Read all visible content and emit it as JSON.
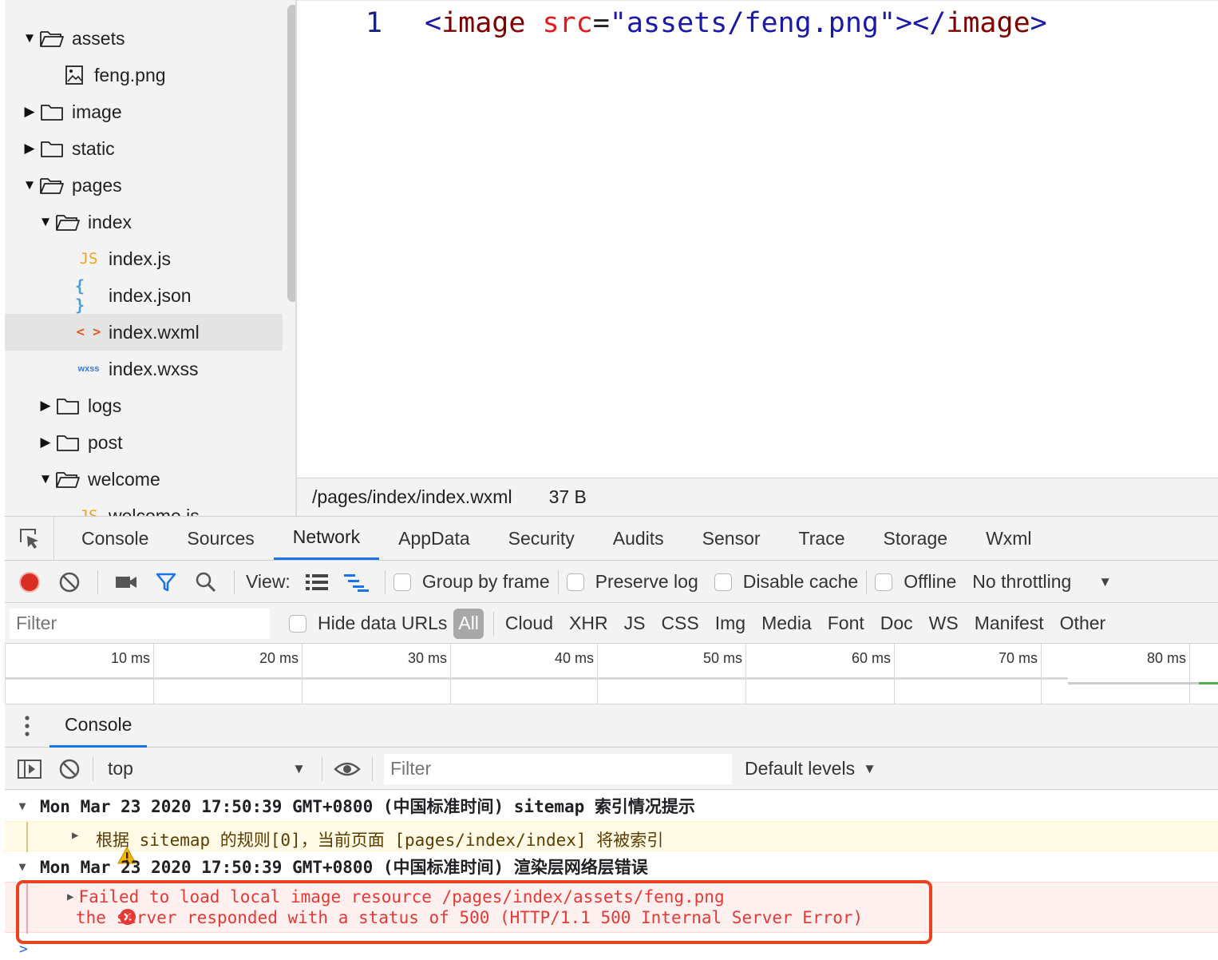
{
  "file_tree": [
    {
      "label": "assets",
      "type": "folder",
      "expanded": true
    },
    {
      "label": "feng.png",
      "type": "image"
    },
    {
      "label": "image",
      "type": "folder",
      "expanded": false
    },
    {
      "label": "static",
      "type": "folder",
      "expanded": false
    },
    {
      "label": "pages",
      "type": "folder",
      "expanded": true
    },
    {
      "label": "index",
      "type": "folder",
      "expanded": true
    },
    {
      "label": "index.js",
      "type": "js",
      "icon_text": "JS"
    },
    {
      "label": "index.json",
      "type": "json",
      "icon_text": "{ }"
    },
    {
      "label": "index.wxml",
      "type": "wxml",
      "icon_text": "< >",
      "selected": true
    },
    {
      "label": "index.wxss",
      "type": "wxss",
      "icon_text": "wxss"
    },
    {
      "label": "logs",
      "type": "folder",
      "expanded": false
    },
    {
      "label": "post",
      "type": "folder",
      "expanded": false
    },
    {
      "label": "welcome",
      "type": "folder",
      "expanded": true
    },
    {
      "label": "welcome.js",
      "type": "js",
      "icon_text": "JS"
    }
  ],
  "editor": {
    "line_number": "1",
    "tokens": {
      "open_bracket": "<",
      "tag_name": "image",
      "attr": "src",
      "equals": "=",
      "value": "\"assets/feng.png\"",
      "close_open": ">",
      "end_open": "</",
      "end_tag_name": "image",
      "end_close": ">"
    }
  },
  "status_bar": {
    "path": "/pages/index/index.wxml",
    "size": "37 B"
  },
  "devtools": {
    "tabs": [
      "Console",
      "Sources",
      "Network",
      "AppData",
      "Security",
      "Audits",
      "Sensor",
      "Trace",
      "Storage",
      "Wxml"
    ],
    "active_tab": "Network"
  },
  "network_toolbar": {
    "view_label": "View:",
    "group_by_frame": "Group by frame",
    "preserve_log": "Preserve log",
    "disable_cache": "Disable cache",
    "offline": "Offline",
    "throttling": "No throttling"
  },
  "filter_bar": {
    "placeholder": "Filter",
    "hide_data_urls": "Hide data URLs",
    "types": [
      "All",
      "Cloud",
      "XHR",
      "JS",
      "CSS",
      "Img",
      "Media",
      "Font",
      "Doc",
      "WS",
      "Manifest",
      "Other"
    ],
    "active_type": "All"
  },
  "timeline": {
    "ticks": [
      "10 ms",
      "20 ms",
      "30 ms",
      "40 ms",
      "50 ms",
      "60 ms",
      "70 ms",
      "80 ms"
    ]
  },
  "drawer": {
    "tab": "Console"
  },
  "console_toolbar": {
    "context": "top",
    "filter_placeholder": "Filter",
    "levels": "Default levels"
  },
  "console": {
    "group1_header": "Mon Mar 23 2020 17:50:39 GMT+0800 (中国标准时间) sitemap 索引情况提示",
    "warning_text": "根据 sitemap 的规则[0]，当前页面 [pages/index/index] 将被索引",
    "group2_header": "Mon Mar 23 2020 17:50:39 GMT+0800 (中国标准时间) 渲染层网络层错误",
    "error_line1": "Failed to load local image resource /pages/index/assets/feng.png",
    "error_line2": "the server responded with a status of 500 (HTTP/1.1 500 Internal Server Error)",
    "prompt": ">"
  },
  "colors": {
    "accent": "#1a73e8",
    "record": "#d93025",
    "error_text": "#e53935",
    "highlight_box": "#e8431f",
    "warning_bg": "#fffbe6",
    "error_bg": "#fff0f0"
  }
}
